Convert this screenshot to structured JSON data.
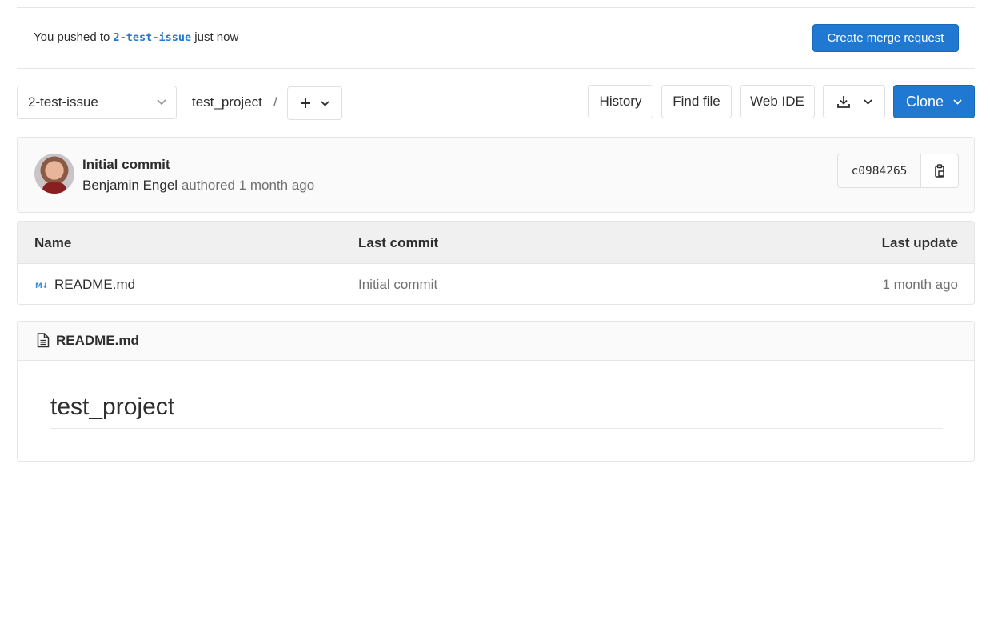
{
  "banner": {
    "prefix": "You pushed to",
    "branch": "2-test-issue",
    "suffix": "just now",
    "merge_button": "Create merge request"
  },
  "toolbar": {
    "branch_select": "2-test-issue",
    "breadcrumb_project": "test_project",
    "breadcrumb_separator": "/",
    "history_button": "History",
    "find_file_button": "Find file",
    "web_ide_button": "Web IDE",
    "clone_button": "Clone"
  },
  "commit": {
    "title": "Initial commit",
    "author": "Benjamin Engel",
    "action": "authored",
    "time": "1 month ago",
    "sha": "c0984265"
  },
  "file_table": {
    "headers": {
      "name": "Name",
      "last_commit": "Last commit",
      "last_update": "Last update"
    },
    "rows": [
      {
        "icon": "M↓",
        "name": "README.md",
        "last_commit": "Initial commit",
        "last_update": "1 month ago"
      }
    ]
  },
  "readme": {
    "filename": "README.md",
    "heading": "test_project"
  },
  "colors": {
    "primary": "#1f78d1",
    "text": "#2e2e2e",
    "muted": "#707070",
    "border": "#e5e5e5"
  }
}
